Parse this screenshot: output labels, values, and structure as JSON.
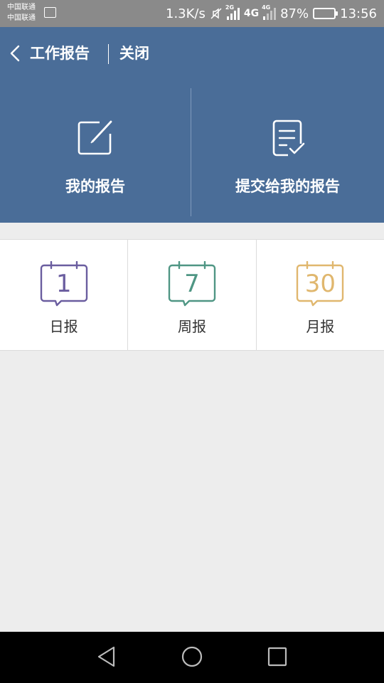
{
  "status_bar": {
    "carrier_1": "中国联通",
    "carrier_2": "中国联通",
    "speed": "1.3K/s",
    "net_2g": "2G",
    "net_4g": "4G",
    "battery_percent": "87%",
    "battery_level": 0.87,
    "time": "13:56"
  },
  "header": {
    "title": "工作报告",
    "close_label": "关闭"
  },
  "actions": [
    {
      "label": "我的报告",
      "icon": "edit-icon"
    },
    {
      "label": "提交给我的报告",
      "icon": "report-check-icon"
    }
  ],
  "report_types": [
    {
      "number": "1",
      "label": "日报",
      "color": "#6a5d9f"
    },
    {
      "number": "7",
      "label": "周报",
      "color": "#4f9684"
    },
    {
      "number": "30",
      "label": "月报",
      "color": "#e0b76e"
    }
  ],
  "colors": {
    "header_bg": "#4a6d98",
    "page_bg": "#ededed",
    "status_bar_bg": "#8a8a8a"
  }
}
